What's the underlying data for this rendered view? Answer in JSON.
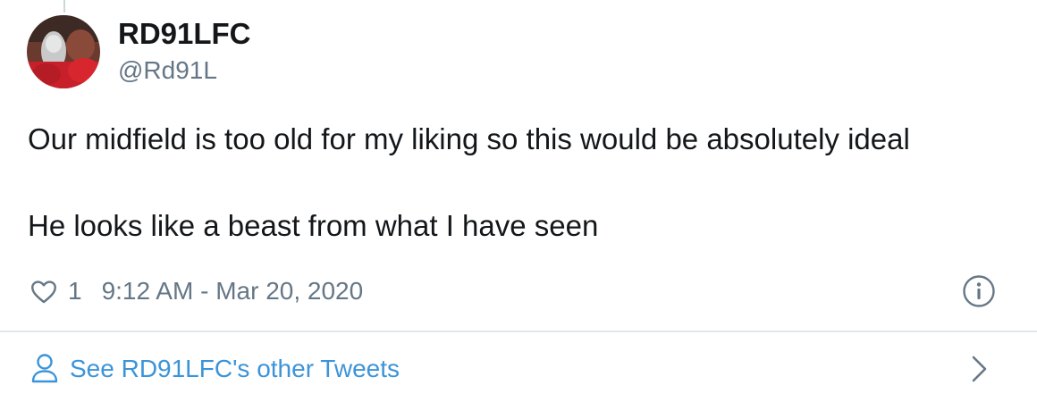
{
  "tweet": {
    "author": {
      "display_name": "RD91LFC",
      "handle": "@Rd91L",
      "avatar_icon": "profile-photo"
    },
    "text_lines": [
      "Our midfield is too old for my liking so this would be absolutely ideal",
      "He looks like a beast from what I have seen"
    ],
    "likes": "1",
    "timestamp": "9:12 AM - Mar 20, 2020",
    "icons": {
      "like": "heart-icon",
      "info": "info-icon"
    }
  },
  "footer": {
    "link_label": "See RD91LFC's other Tweets",
    "icons": {
      "person": "person-icon",
      "chevron": "chevron-right-icon"
    }
  },
  "colors": {
    "text_primary": "#14171a",
    "text_secondary": "#657786",
    "link": "#3b94d9",
    "divider": "#e1e8ed"
  }
}
